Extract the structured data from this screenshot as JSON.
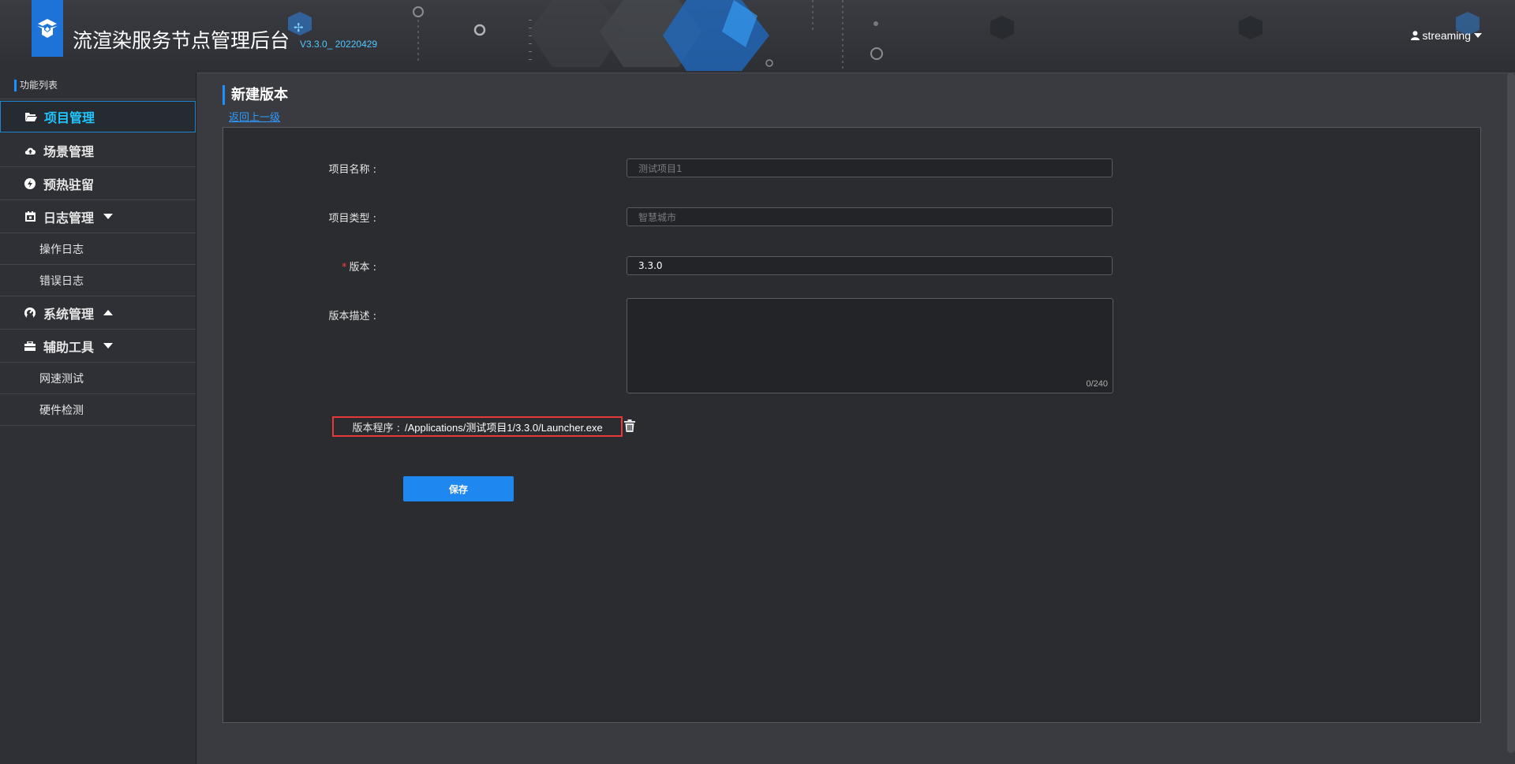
{
  "header": {
    "title": "流渲染服务节点管理后台",
    "version": "V3.3.0_ 20220429",
    "user": "streaming"
  },
  "sidebar": {
    "heading": "功能列表",
    "items": [
      {
        "label": "项目管理",
        "icon": "folder-open-icon"
      },
      {
        "label": "场景管理",
        "icon": "cloud-upload-icon"
      },
      {
        "label": "预热驻留",
        "icon": "bolt-icon"
      },
      {
        "label": "日志管理",
        "icon": "calendar-icon"
      },
      {
        "label": "系统管理",
        "icon": "dashboard-icon"
      },
      {
        "label": "辅助工具",
        "icon": "toolbox-icon"
      }
    ],
    "log_subitems": [
      "操作日志",
      "错误日志"
    ],
    "tools_subitems": [
      "网速测试",
      "硬件检测"
    ]
  },
  "page": {
    "title": "新建版本",
    "back_link": "返回上一级"
  },
  "form": {
    "project_name_label": "项目名称 :",
    "project_name_value": "测试项目1",
    "project_type_label": "项目类型 :",
    "project_type_value": "智慧城市",
    "version_required_mark": "*",
    "version_label": "版本 :",
    "version_value": "3.3.0",
    "description_label": "版本描述 :",
    "description_counter": "0/240",
    "program_label": "版本程序 :",
    "program_path": "/Applications/测试项目1/3.3.0/Launcher.exe",
    "save_label": "保存"
  },
  "colors": {
    "accent": "#1e87f0",
    "active_text": "#22c6ff",
    "highlight_border": "#e8383c"
  }
}
